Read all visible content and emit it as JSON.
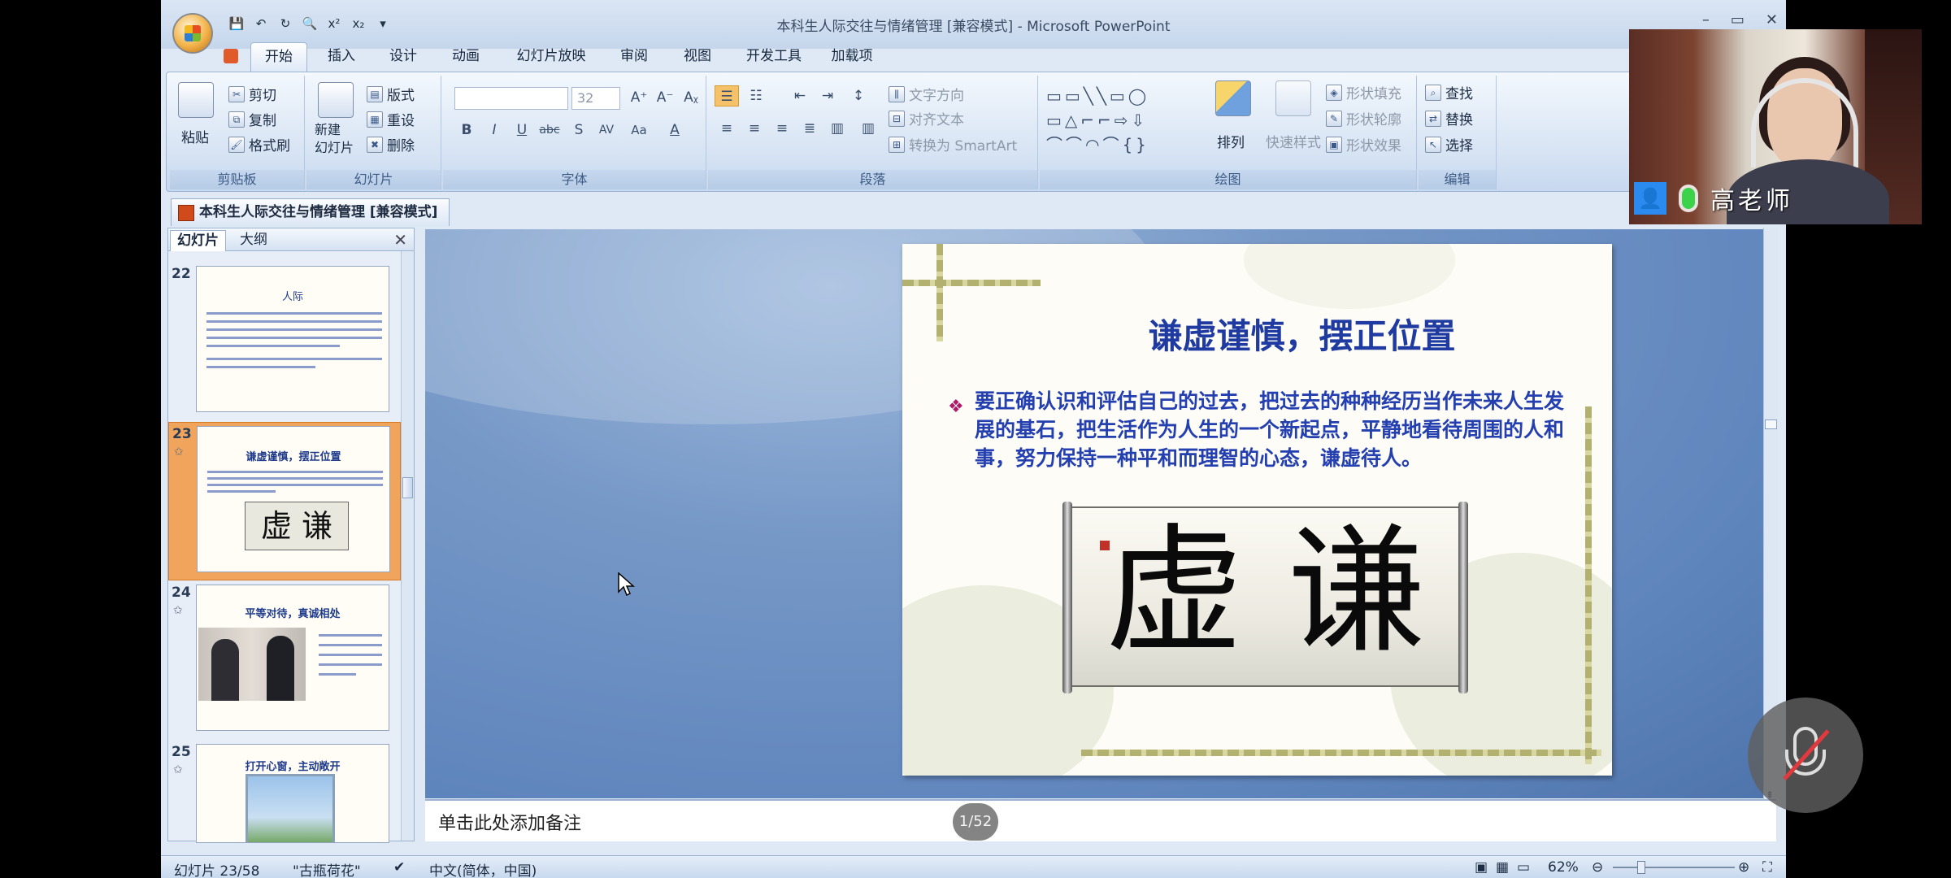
{
  "window": {
    "title": "本科生人际交往与情绪管理 [兼容模式] - Microsoft PowerPoint",
    "controls": [
      "–",
      "▭",
      "✕"
    ]
  },
  "ribbon_tabs": [
    "开始",
    "插入",
    "设计",
    "动画",
    "幻灯片放映",
    "审阅",
    "视图",
    "开发工具",
    "加载项"
  ],
  "active_tab": "开始",
  "ribbon": {
    "clipboard": {
      "paste": "粘贴",
      "cut": "剪切",
      "copy": "复制",
      "format_painter": "格式刷",
      "label": "剪贴板"
    },
    "slides": {
      "new_slide": "新建\n幻灯片",
      "layout": "版式",
      "reset": "重设",
      "delete": "删除",
      "label": "幻灯片"
    },
    "font": {
      "font_name": "",
      "font_size": "32",
      "label": "字体"
    },
    "paragraph": {
      "text_direction": "文字方向",
      "align_text": "对齐文本",
      "smartart": "转换为 SmartArt",
      "label": "段落"
    },
    "drawing": {
      "arrange": "排列",
      "quick_styles": "快速样式",
      "shape_fill": "形状填充",
      "shape_outline": "形状轮廓",
      "shape_effects": "形状效果",
      "label": "绘图"
    },
    "editing": {
      "find": "查找",
      "replace": "替换",
      "select": "选择",
      "label": "编辑"
    }
  },
  "document_tab": "本科生人际交往与情绪管理 [兼容模式]",
  "pane_tabs": {
    "slides": "幻灯片",
    "outline": "大纲"
  },
  "thumbnails": [
    {
      "num": "22",
      "title": "人际",
      "selected": false
    },
    {
      "num": "23",
      "title": "谦虚谨慎，摆正位置",
      "selected": true
    },
    {
      "num": "24",
      "title": "平等对待，真诚相处",
      "selected": false
    },
    {
      "num": "25",
      "title": "打开心窗，主动敞开",
      "selected": false
    }
  ],
  "slide": {
    "title": "谦虚谨慎，摆正位置",
    "bullet": "要正确认识和评估自己的过去，把过去的种种经历当作未来人生发展的基石，把生活作为人生的一个新起点，平静地看待周围的人和事，努力保持一种平和而理智的心态，谦虚待人。",
    "calligraphy": "虚 谦"
  },
  "notes_placeholder": "单击此处添加备注",
  "status": {
    "slide_index": "幻灯片 23/58",
    "theme": "\"古瓶荷花\"",
    "language": "中文(简体，中国)",
    "zoom": "62%"
  },
  "overlay": {
    "speaker_name": "高老师",
    "page_counter": "1/52"
  },
  "colors": {
    "slide_title": "#1f3aa0",
    "slide_body": "#233fb0",
    "selected_thumb": "#f1a55c",
    "mic_on": "#3cd24a",
    "mic_off_slash": "#e0393e"
  }
}
